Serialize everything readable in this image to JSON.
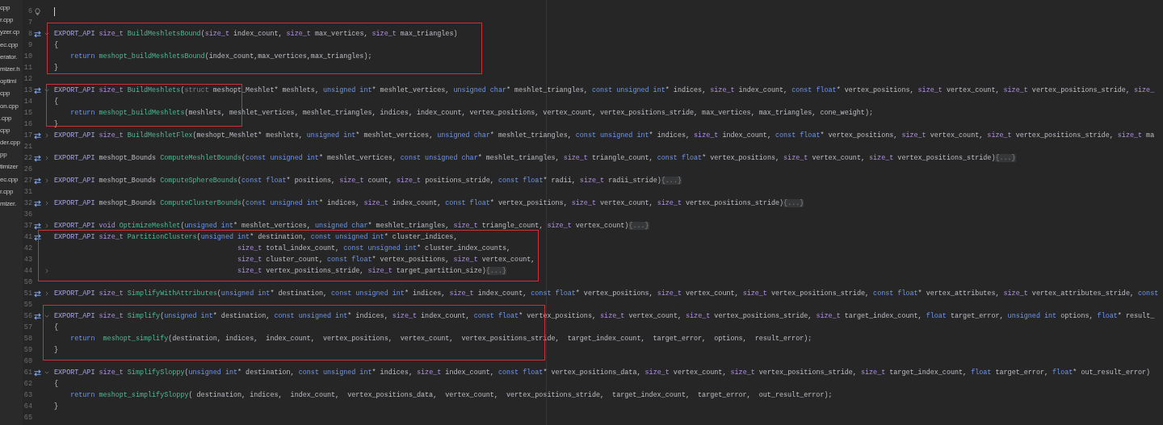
{
  "sidebar": {
    "files": [
      {
        "name": "cpp"
      },
      {
        "name": "r.cpp"
      },
      {
        "name": "yzer.cp"
      },
      {
        "name": "ec.cpp"
      },
      {
        "name": "erator."
      },
      {
        "name": "mizer.h"
      },
      {
        "name": "optimi"
      },
      {
        "name": "cpp"
      },
      {
        "name": "on.cpp"
      },
      {
        "name": ".cpp"
      },
      {
        "name": "cpp"
      },
      {
        "name": "der.cpp"
      },
      {
        "name": "pp"
      },
      {
        "name": "timizer"
      },
      {
        "name": "ec.cpp"
      },
      {
        "name": "r.cpp"
      },
      {
        "name": "mizer."
      }
    ]
  },
  "editor": {
    "blocks": [
      {
        "highlighted": false,
        "lines": [
          {
            "number": "6",
            "caret": true,
            "gutter": [
              {
                "kind": "bulb"
              }
            ]
          },
          {
            "number": "7",
            "caret": false
          }
        ]
      },
      {
        "highlighted": true,
        "lines": [
          {
            "number": "8",
            "caret": false,
            "gutter": [
              {
                "kind": "implements"
              },
              {
                "kind": "expanded"
              }
            ],
            "tokens": [
              {
                "kind": "macro",
                "text": "EXPORT_API"
              },
              {
                "kind": "type",
                "text": " size_t"
              },
              {
                "kind": "function",
                "text": " BuildMeshletsBound"
              },
              {
                "kind": "plain",
                "text": "("
              },
              {
                "kind": "type",
                "text": "size_t"
              },
              {
                "kind": "plain",
                "text": " index_count, "
              },
              {
                "kind": "type",
                "text": "size_t"
              },
              {
                "kind": "plain",
                "text": " max_vertices, "
              },
              {
                "kind": "type",
                "text": "size_t"
              },
              {
                "kind": "plain",
                "text": " max_triangles)"
              }
            ]
          },
          {
            "number": "9",
            "caret": false,
            "tokens": [
              {
                "kind": "plain",
                "text": "{"
              }
            ]
          },
          {
            "number": "10",
            "caret": false,
            "tokens": [
              {
                "kind": "keyword",
                "text": "    return"
              },
              {
                "kind": "function",
                "text": " meshopt_buildMeshletsBound"
              },
              {
                "kind": "plain",
                "text": "(index_count,max_vertices,max_triangles);"
              }
            ]
          },
          {
            "number": "11",
            "caret": false,
            "tokens": [
              {
                "kind": "plain",
                "text": "}"
              }
            ]
          }
        ]
      },
      {
        "highlighted": false,
        "lines": [
          {
            "number": "12",
            "caret": false
          }
        ]
      },
      {
        "highlighted": true,
        "lines": [
          {
            "number": "13",
            "caret": false,
            "gutter": [
              {
                "kind": "implements"
              },
              {
                "kind": "expanded"
              }
            ],
            "tokens": [
              {
                "kind": "macro",
                "text": "EXPORT_API"
              },
              {
                "kind": "type",
                "text": " size_t"
              },
              {
                "kind": "function",
                "text": " BuildMeshlets"
              },
              {
                "kind": "plain",
                "text": "("
              },
              {
                "kind": "muted",
                "text": "struct"
              },
              {
                "kind": "plain",
                "text": " meshopt_Meshlet* meshlets, "
              },
              {
                "kind": "keyword",
                "text": "unsigned int"
              },
              {
                "kind": "plain",
                "text": "* meshlet_vertices, "
              },
              {
                "kind": "keyword",
                "text": "unsigned char"
              },
              {
                "kind": "plain",
                "text": "* meshlet_triangles, "
              },
              {
                "kind": "keyword",
                "text": "const unsigned int"
              },
              {
                "kind": "plain",
                "text": "* indices, "
              },
              {
                "kind": "type",
                "text": "size_t"
              },
              {
                "kind": "plain",
                "text": " index_count, "
              },
              {
                "kind": "keyword",
                "text": "const float"
              },
              {
                "kind": "plain",
                "text": "* vertex_positions, "
              },
              {
                "kind": "type",
                "text": "size_t"
              },
              {
                "kind": "plain",
                "text": " vertex_count, "
              },
              {
                "kind": "type",
                "text": "size_t"
              },
              {
                "kind": "plain",
                "text": " vertex_positions_stride, "
              },
              {
                "kind": "type",
                "text": "size_"
              }
            ]
          },
          {
            "number": "14",
            "caret": false,
            "tokens": [
              {
                "kind": "plain",
                "text": "{"
              }
            ]
          },
          {
            "number": "15",
            "caret": false,
            "tokens": [
              {
                "kind": "keyword",
                "text": "    return"
              },
              {
                "kind": "function",
                "text": " meshopt_buildMeshlets"
              },
              {
                "kind": "plain",
                "text": "(meshlets, meshlet_vertices, meshlet_triangles, indices, index_count, vertex_positions, vertex_count, vertex_positions_stride, max_vertices, max_triangles, cone_weight);"
              }
            ]
          },
          {
            "number": "16",
            "caret": false,
            "tokens": [
              {
                "kind": "plain",
                "text": "}"
              }
            ]
          }
        ]
      },
      {
        "highlighted": false,
        "lines": [
          {
            "number": "17",
            "caret": false,
            "gutter": [
              {
                "kind": "implements"
              },
              {
                "kind": "collapsed"
              }
            ],
            "tokens": [
              {
                "kind": "macro",
                "text": "EXPORT_API"
              },
              {
                "kind": "type",
                "text": " size_t"
              },
              {
                "kind": "function",
                "text": " BuildMeshletFlex"
              },
              {
                "kind": "plain",
                "text": "(meshopt_Meshlet* meshlets, "
              },
              {
                "kind": "keyword",
                "text": "unsigned int"
              },
              {
                "kind": "plain",
                "text": "* meshlet_vertices, "
              },
              {
                "kind": "keyword",
                "text": "unsigned char"
              },
              {
                "kind": "plain",
                "text": "* meshlet_triangles, "
              },
              {
                "kind": "keyword",
                "text": "const unsigned int"
              },
              {
                "kind": "plain",
                "text": "* indices, "
              },
              {
                "kind": "type",
                "text": "size_t"
              },
              {
                "kind": "plain",
                "text": " index_count, "
              },
              {
                "kind": "keyword",
                "text": "const float"
              },
              {
                "kind": "plain",
                "text": "* vertex_positions, "
              },
              {
                "kind": "type",
                "text": "size_t"
              },
              {
                "kind": "plain",
                "text": " vertex_count, "
              },
              {
                "kind": "type",
                "text": "size_t"
              },
              {
                "kind": "plain",
                "text": " vertex_positions_stride, "
              },
              {
                "kind": "type",
                "text": "size_t"
              },
              {
                "kind": "plain",
                "text": " ma"
              }
            ]
          },
          {
            "number": "21",
            "caret": false
          },
          {
            "number": "22",
            "caret": false,
            "gutter": [
              {
                "kind": "implements"
              },
              {
                "kind": "collapsed"
              }
            ],
            "tokens": [
              {
                "kind": "macro",
                "text": "EXPORT_API"
              },
              {
                "kind": "plain",
                "text": " meshopt_Bounds"
              },
              {
                "kind": "function",
                "text": " ComputeMeshletBounds"
              },
              {
                "kind": "plain",
                "text": "("
              },
              {
                "kind": "keyword",
                "text": "const unsigned int"
              },
              {
                "kind": "plain",
                "text": "* meshlet_vertices, "
              },
              {
                "kind": "keyword",
                "text": "const unsigned char"
              },
              {
                "kind": "plain",
                "text": "* meshlet_triangles, "
              },
              {
                "kind": "type",
                "text": "size_t"
              },
              {
                "kind": "plain",
                "text": " triangle_count, "
              },
              {
                "kind": "keyword",
                "text": "const float"
              },
              {
                "kind": "plain",
                "text": "* vertex_positions, "
              },
              {
                "kind": "type",
                "text": "size_t"
              },
              {
                "kind": "plain",
                "text": " vertex_count, "
              },
              {
                "kind": "type",
                "text": "size_t"
              },
              {
                "kind": "plain",
                "text": " vertex_positions_stride)"
              },
              {
                "kind": "folded",
                "text": "{...}"
              }
            ]
          },
          {
            "number": "26",
            "caret": false
          },
          {
            "number": "27",
            "caret": false,
            "gutter": [
              {
                "kind": "implements"
              },
              {
                "kind": "collapsed"
              }
            ],
            "tokens": [
              {
                "kind": "macro",
                "text": "EXPORT_API"
              },
              {
                "kind": "plain",
                "text": " meshopt_Bounds"
              },
              {
                "kind": "function",
                "text": " ComputeSphereBounds"
              },
              {
                "kind": "plain",
                "text": "("
              },
              {
                "kind": "keyword",
                "text": "const float"
              },
              {
                "kind": "plain",
                "text": "* positions, "
              },
              {
                "kind": "type",
                "text": "size_t"
              },
              {
                "kind": "plain",
                "text": " count, "
              },
              {
                "kind": "type",
                "text": "size_t"
              },
              {
                "kind": "plain",
                "text": " positions_stride, "
              },
              {
                "kind": "keyword",
                "text": "const float"
              },
              {
                "kind": "plain",
                "text": "* radii, "
              },
              {
                "kind": "type",
                "text": "size_t"
              },
              {
                "kind": "plain",
                "text": " radii_stride)"
              },
              {
                "kind": "folded",
                "text": "{...}"
              }
            ]
          },
          {
            "number": "31",
            "caret": false
          },
          {
            "number": "32",
            "caret": false,
            "gutter": [
              {
                "kind": "implements"
              },
              {
                "kind": "collapsed"
              }
            ],
            "tokens": [
              {
                "kind": "macro",
                "text": "EXPORT_API"
              },
              {
                "kind": "plain",
                "text": " meshopt_Bounds"
              },
              {
                "kind": "function",
                "text": " ComputeClusterBounds"
              },
              {
                "kind": "plain",
                "text": "("
              },
              {
                "kind": "keyword",
                "text": "const unsigned int"
              },
              {
                "kind": "plain",
                "text": "* indices, "
              },
              {
                "kind": "type",
                "text": "size_t"
              },
              {
                "kind": "plain",
                "text": " index_count, "
              },
              {
                "kind": "keyword",
                "text": "const float"
              },
              {
                "kind": "plain",
                "text": "* vertex_positions, "
              },
              {
                "kind": "type",
                "text": "size_t"
              },
              {
                "kind": "plain",
                "text": " vertex_count, "
              },
              {
                "kind": "type",
                "text": "size_t"
              },
              {
                "kind": "plain",
                "text": " vertex_positions_stride)"
              },
              {
                "kind": "folded",
                "text": "{...}"
              }
            ]
          },
          {
            "number": "36",
            "caret": false
          },
          {
            "number": "37",
            "caret": false,
            "gutter": [
              {
                "kind": "implements"
              },
              {
                "kind": "collapsed"
              }
            ],
            "tokens": [
              {
                "kind": "macro",
                "text": "EXPORT_API"
              },
              {
                "kind": "type",
                "text": " void"
              },
              {
                "kind": "function",
                "text": " OptimizeMeshlet"
              },
              {
                "kind": "plain",
                "text": "("
              },
              {
                "kind": "keyword",
                "text": "unsigned int"
              },
              {
                "kind": "plain",
                "text": "* meshlet_vertices, "
              },
              {
                "kind": "keyword",
                "text": "unsigned char"
              },
              {
                "kind": "plain",
                "text": "* meshlet_triangles, "
              },
              {
                "kind": "type",
                "text": "size_t"
              },
              {
                "kind": "plain",
                "text": " triangle_count, "
              },
              {
                "kind": "type",
                "text": "size_t"
              },
              {
                "kind": "plain",
                "text": " vertex_count)"
              },
              {
                "kind": "folded",
                "text": "{...}"
              }
            ]
          }
        ]
      },
      {
        "highlighted": true,
        "lines": [
          {
            "number": "41",
            "caret": false,
            "gutter": [
              {
                "kind": "implements"
              }
            ],
            "tokens": [
              {
                "kind": "macro",
                "text": "EXPORT_API"
              },
              {
                "kind": "type",
                "text": " size_t"
              },
              {
                "kind": "function",
                "text": " PartitionClusters"
              },
              {
                "kind": "plain",
                "text": "("
              },
              {
                "kind": "keyword",
                "text": "unsigned int"
              },
              {
                "kind": "plain",
                "text": "* destination, "
              },
              {
                "kind": "keyword",
                "text": "const unsigned int"
              },
              {
                "kind": "plain",
                "text": "* cluster_indices,"
              }
            ]
          },
          {
            "number": "42",
            "caret": false,
            "tokens": [
              {
                "kind": "type",
                "text": "                                             size_t"
              },
              {
                "kind": "plain",
                "text": " total_index_count, "
              },
              {
                "kind": "keyword",
                "text": "const unsigned int"
              },
              {
                "kind": "plain",
                "text": "* cluster_index_counts,"
              }
            ]
          },
          {
            "number": "43",
            "caret": false,
            "tokens": [
              {
                "kind": "type",
                "text": "                                             size_t"
              },
              {
                "kind": "plain",
                "text": " cluster_count, "
              },
              {
                "kind": "keyword",
                "text": "const float"
              },
              {
                "kind": "plain",
                "text": "* vertex_positions, "
              },
              {
                "kind": "type",
                "text": "size_t"
              },
              {
                "kind": "plain",
                "text": " vertex_count,"
              }
            ]
          },
          {
            "number": "44",
            "caret": false,
            "gutter": [
              {
                "kind": "collapsed"
              }
            ],
            "tokens": [
              {
                "kind": "type",
                "text": "                                             size_t"
              },
              {
                "kind": "plain",
                "text": " vertex_positions_stride, "
              },
              {
                "kind": "type",
                "text": "size_t"
              },
              {
                "kind": "plain",
                "text": " target_partition_size)"
              },
              {
                "kind": "folded",
                "text": "{...}"
              }
            ]
          },
          {
            "number": "50",
            "caret": false
          }
        ]
      },
      {
        "highlighted": false,
        "lines": [
          {
            "number": "51",
            "caret": false,
            "gutter": [
              {
                "kind": "implements"
              },
              {
                "kind": "collapsed"
              }
            ],
            "tokens": [
              {
                "kind": "macro",
                "text": "EXPORT_API"
              },
              {
                "kind": "type",
                "text": " size_t"
              },
              {
                "kind": "function",
                "text": " SimplifyWithAttributes"
              },
              {
                "kind": "plain",
                "text": "("
              },
              {
                "kind": "keyword",
                "text": "unsigned int"
              },
              {
                "kind": "plain",
                "text": "* destination, "
              },
              {
                "kind": "keyword",
                "text": "const unsigned int"
              },
              {
                "kind": "plain",
                "text": "* indices, "
              },
              {
                "kind": "type",
                "text": "size_t"
              },
              {
                "kind": "plain",
                "text": " index_count, "
              },
              {
                "kind": "keyword",
                "text": "const float"
              },
              {
                "kind": "plain",
                "text": "* vertex_positions, "
              },
              {
                "kind": "type",
                "text": "size_t"
              },
              {
                "kind": "plain",
                "text": " vertex_count, "
              },
              {
                "kind": "type",
                "text": "size_t"
              },
              {
                "kind": "plain",
                "text": " vertex_positions_stride, "
              },
              {
                "kind": "keyword",
                "text": "const float"
              },
              {
                "kind": "plain",
                "text": "* vertex_attributes, "
              },
              {
                "kind": "type",
                "text": "size_t"
              },
              {
                "kind": "plain",
                "text": " vertex_attributes_stride, "
              },
              {
                "kind": "keyword",
                "text": "const"
              }
            ]
          },
          {
            "number": "55",
            "caret": false
          }
        ]
      },
      {
        "highlighted": true,
        "lines": [
          {
            "number": "56",
            "caret": false,
            "gutter": [
              {
                "kind": "implements"
              },
              {
                "kind": "expanded"
              }
            ],
            "tokens": [
              {
                "kind": "macro",
                "text": "EXPORT_API"
              },
              {
                "kind": "type",
                "text": " size_t"
              },
              {
                "kind": "function",
                "text": " Simplify"
              },
              {
                "kind": "plain",
                "text": "("
              },
              {
                "kind": "keyword",
                "text": "unsigned int"
              },
              {
                "kind": "plain",
                "text": "* destination, "
              },
              {
                "kind": "keyword",
                "text": "const unsigned int"
              },
              {
                "kind": "plain",
                "text": "* indices, "
              },
              {
                "kind": "type",
                "text": "size_t"
              },
              {
                "kind": "plain",
                "text": " index_count, "
              },
              {
                "kind": "keyword",
                "text": "const float"
              },
              {
                "kind": "plain",
                "text": "* vertex_positions, "
              },
              {
                "kind": "type",
                "text": "size_t"
              },
              {
                "kind": "plain",
                "text": " vertex_count, "
              },
              {
                "kind": "type",
                "text": "size_t"
              },
              {
                "kind": "plain",
                "text": " vertex_positions_stride, "
              },
              {
                "kind": "type",
                "text": "size_t"
              },
              {
                "kind": "plain",
                "text": " target_index_count, "
              },
              {
                "kind": "keyword",
                "text": "float"
              },
              {
                "kind": "plain",
                "text": " target_error, "
              },
              {
                "kind": "keyword",
                "text": "unsigned int"
              },
              {
                "kind": "plain",
                "text": " options, "
              },
              {
                "kind": "keyword",
                "text": "float"
              },
              {
                "kind": "plain",
                "text": "* result_"
              }
            ]
          },
          {
            "number": "57",
            "caret": false,
            "tokens": [
              {
                "kind": "plain",
                "text": "{"
              }
            ]
          },
          {
            "number": "58",
            "caret": false,
            "tokens": [
              {
                "kind": "keyword",
                "text": "    return"
              },
              {
                "kind": "function",
                "text": "  meshopt_simplify"
              },
              {
                "kind": "plain",
                "text": "(destination, indices,  index_count,  vertex_positions,  vertex_count,  vertex_positions_stride,  target_index_count,  target_error,  options,  result_error);"
              }
            ]
          },
          {
            "number": "59",
            "caret": false,
            "tokens": [
              {
                "kind": "plain",
                "text": "}"
              }
            ]
          },
          {
            "number": "60",
            "caret": false
          }
        ]
      },
      {
        "highlighted": false,
        "lines": [
          {
            "number": "61",
            "caret": false,
            "gutter": [
              {
                "kind": "implements"
              },
              {
                "kind": "expanded"
              }
            ],
            "tokens": [
              {
                "kind": "macro",
                "text": "EXPORT_API"
              },
              {
                "kind": "type",
                "text": " size_t"
              },
              {
                "kind": "function",
                "text": " SimplifySloppy"
              },
              {
                "kind": "plain",
                "text": "("
              },
              {
                "kind": "keyword",
                "text": "unsigned int"
              },
              {
                "kind": "plain",
                "text": "* destination, "
              },
              {
                "kind": "keyword",
                "text": "const unsigned int"
              },
              {
                "kind": "plain",
                "text": "* indices, "
              },
              {
                "kind": "type",
                "text": "size_t"
              },
              {
                "kind": "plain",
                "text": " index_count, "
              },
              {
                "kind": "keyword",
                "text": "const float"
              },
              {
                "kind": "plain",
                "text": "* vertex_positions_data, "
              },
              {
                "kind": "type",
                "text": "size_t"
              },
              {
                "kind": "plain",
                "text": " vertex_count, "
              },
              {
                "kind": "type",
                "text": "size_t"
              },
              {
                "kind": "plain",
                "text": " vertex_positions_stride, "
              },
              {
                "kind": "type",
                "text": "size_t"
              },
              {
                "kind": "plain",
                "text": " target_index_count, "
              },
              {
                "kind": "keyword",
                "text": "float"
              },
              {
                "kind": "plain",
                "text": " target_error, "
              },
              {
                "kind": "keyword",
                "text": "float"
              },
              {
                "kind": "plain",
                "text": "* out_result_error)"
              }
            ]
          },
          {
            "number": "62",
            "caret": false,
            "tokens": [
              {
                "kind": "plain",
                "text": "{"
              }
            ]
          },
          {
            "number": "63",
            "caret": false,
            "tokens": [
              {
                "kind": "keyword",
                "text": "    return"
              },
              {
                "kind": "function",
                "text": " meshopt_simplifySloppy"
              },
              {
                "kind": "plain",
                "text": "( destination, indices,  index_count,  vertex_positions_data,  vertex_count,  vertex_positions_stride,  target_index_count,  target_error,  out_result_error);"
              }
            ]
          },
          {
            "number": "64",
            "caret": false,
            "tokens": [
              {
                "kind": "plain",
                "text": "}"
              }
            ]
          },
          {
            "number": "65",
            "caret": false
          }
        ]
      }
    ]
  }
}
